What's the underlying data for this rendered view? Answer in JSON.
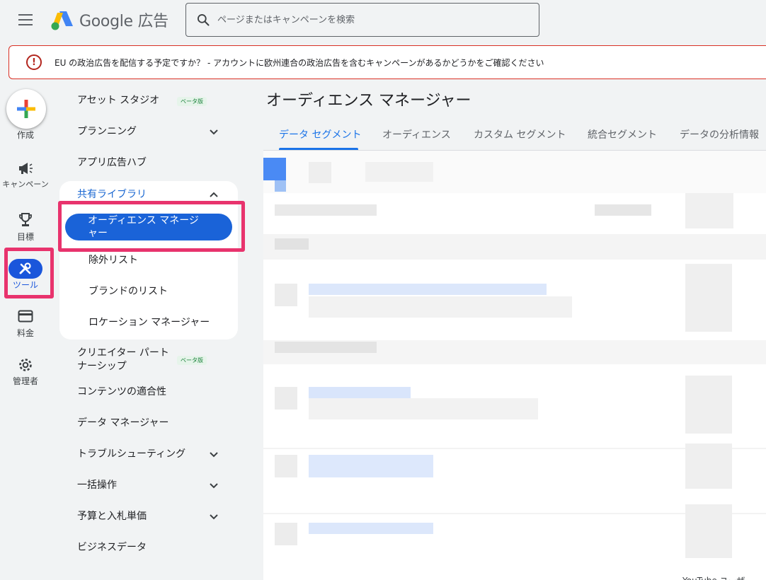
{
  "header": {
    "logo_text": "Google 広告",
    "search_placeholder": "ページまたはキャンペーンを検索"
  },
  "alert": {
    "icon": "error-icon",
    "text": "EU の政治広告を配信する予定ですか？ - アカウントに欧州連合の政治広告を含むキャンペーンがあるかどうかをご確認ください",
    "color": "#d93025"
  },
  "rail": {
    "create": "作成",
    "campaigns": "キャンペーン",
    "goals": "目標",
    "tools": "ツール",
    "billing": "料金",
    "admin": "管理者"
  },
  "nav": {
    "asset_studio": "アセット スタジオ",
    "asset_studio_badge": "ベータ版",
    "planning": "プランニング",
    "app_ads_hub": "アプリ広告ハブ",
    "shared_library": "共有ライブラリ",
    "audience_manager": "オーディエンス マネージャー",
    "exclusion_lists": "除外リスト",
    "brand_lists": "ブランドのリスト",
    "location_manager": "ロケーション マネージャー",
    "creator_partnership_1": "クリエイター パート",
    "creator_partnership_2": "ナーシップ",
    "creator_badge": "ベータ版",
    "content_suitability": "コンテンツの適合性",
    "data_manager": "データ マネージャー",
    "troubleshooting": "トラブルシューティング",
    "bulk_actions": "一括操作",
    "budgets_bidding": "予算と入札単価",
    "business_data": "ビジネスデータ"
  },
  "main": {
    "title": "オーディエンス マネージャー",
    "tabs": [
      "データ セグメント",
      "オーディエンス",
      "カスタム セグメント",
      "統合セグメント",
      "データの分析情報"
    ],
    "active_tab": 0,
    "bottom_fragment": "YouTube ユーザ"
  },
  "colors": {
    "accent": "#1a73e8",
    "highlight": "#e8336d",
    "active_pill": "#1a63d8"
  }
}
